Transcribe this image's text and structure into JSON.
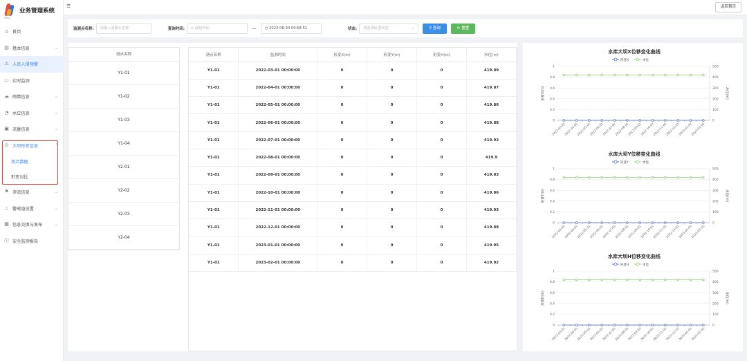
{
  "app": {
    "title": "业务管理系统",
    "logo_sub": "ABAC"
  },
  "topbar": {
    "fold_icon": "☰",
    "back_label": "返回首页"
  },
  "sidebar": {
    "items": [
      {
        "label": "首页",
        "icon": "home-icon",
        "glyph": "⌂",
        "chevron": false
      },
      {
        "label": "基本信息",
        "icon": "info-icon",
        "glyph": "▤",
        "chevron": true
      },
      {
        "label": "人员入侵预警",
        "icon": "alert-icon",
        "glyph": "⚠",
        "chevron": false,
        "active": true
      },
      {
        "label": "实时监测",
        "icon": "monitor-icon",
        "glyph": "▭",
        "chevron": false
      },
      {
        "label": "雨情信息",
        "icon": "rain-icon",
        "glyph": "☁",
        "chevron": true
      },
      {
        "label": "水位信息",
        "icon": "water-icon",
        "glyph": "◔",
        "chevron": true
      },
      {
        "label": "流量信息",
        "icon": "flow-icon",
        "glyph": "▣",
        "chevron": true
      },
      {
        "label": "大坝形变信息",
        "icon": "dam-icon",
        "glyph": "⊙",
        "chevron": true,
        "selected": true
      },
      {
        "label": "测点数据",
        "sub": true,
        "selected": true
      },
      {
        "label": "形变对比",
        "sub": true
      },
      {
        "label": "渗流信息",
        "icon": "seepage-icon",
        "glyph": "⚑",
        "chevron": true
      },
      {
        "label": "警戒值设置",
        "icon": "warning-icon",
        "glyph": "♨",
        "chevron": true
      },
      {
        "label": "信息交换与发布",
        "icon": "exchange-icon",
        "glyph": "▦",
        "chevron": true
      },
      {
        "label": "安全监测报告",
        "icon": "report-icon",
        "glyph": "ⓘ",
        "chevron": false
      }
    ]
  },
  "filter": {
    "station_label": "监测点名称:",
    "station_placeholder": "请输入测量头名称",
    "time_label": "查询时间:",
    "start_placeholder": "起始时间",
    "end_value": "2023-08-30 09:58:51",
    "status_label": "状态:",
    "status_placeholder": "请选择处理状态",
    "query_label": "查询",
    "reset_label": "重置"
  },
  "point_table": {
    "header": "测点名称",
    "rows": [
      "Y1-01",
      "Y1-02",
      "Y1-03",
      "Y1-04",
      "Y2-01",
      "Y2-02",
      "Y2-03",
      "Y2-04"
    ]
  },
  "data_table": {
    "headers": [
      "测点名称",
      "监测时间",
      "形变X(m)",
      "形变Y(m)",
      "形变H(m)",
      "水位(m)"
    ],
    "rows": [
      [
        "Y1-01",
        "2022-03-01 00:00:00",
        "0",
        "0",
        "0",
        "419.89"
      ],
      [
        "Y1-01",
        "2022-04-01 00:00:00",
        "0",
        "0",
        "0",
        "419.87"
      ],
      [
        "Y1-01",
        "2022-05-01 00:00:00",
        "0",
        "0",
        "0",
        "419.86"
      ],
      [
        "Y1-01",
        "2022-06-01 00:00:00",
        "0",
        "0",
        "0",
        "419.88"
      ],
      [
        "Y1-01",
        "2022-07-01 00:00:00",
        "0",
        "0",
        "0",
        "419.92"
      ],
      [
        "Y1-01",
        "2022-08-01 00:00:00",
        "0",
        "0",
        "0",
        "419.9"
      ],
      [
        "Y1-01",
        "2022-09-01 00:00:00",
        "0",
        "0",
        "0",
        "419.83"
      ],
      [
        "Y1-01",
        "2022-10-01 00:00:00",
        "0",
        "0",
        "0",
        "419.86"
      ],
      [
        "Y1-01",
        "2022-11-01 00:00:00",
        "0",
        "0",
        "0",
        "419.93"
      ],
      [
        "Y1-01",
        "2022-12-01 00:00:00",
        "0",
        "0",
        "0",
        "419.88"
      ],
      [
        "Y1-01",
        "2023-01-01 00:00:00",
        "0",
        "0",
        "0",
        "419.95"
      ],
      [
        "Y1-01",
        "2023-02-01 00:00:00",
        "0",
        "0",
        "0",
        "419.92"
      ]
    ]
  },
  "colors": {
    "accent": "#3a8ee6",
    "reset": "#5cb85c",
    "deform_line": "#5470c6",
    "water_line": "#91cc75",
    "highlight_box": "#e0463c"
  },
  "chart_data": [
    {
      "type": "line",
      "title": "水库大坝X位移变化曲线",
      "x": [
        "2022-03-01",
        "2022-04-01",
        "2022-05-01",
        "2022-06-01",
        "2022-07-01",
        "2022-08-01",
        "2022-09-01",
        "2022-10-01",
        "2022-11-01",
        "2022-12-01",
        "2023-01-01",
        "2023-02-01"
      ],
      "ylabel": "形变X(m)",
      "y2label": "水位(m)",
      "ylim": [
        0,
        1
      ],
      "y2lim": [
        0,
        500
      ],
      "yticks": [
        "0",
        "0.2",
        "0.4",
        "0.6",
        "0.8",
        "1"
      ],
      "y2ticks": [
        "0",
        "100",
        "200",
        "300",
        "400",
        "500"
      ],
      "series": [
        {
          "name": "形变X",
          "axis": "left",
          "values": [
            0,
            0,
            0,
            0,
            0,
            0,
            0,
            0,
            0,
            0,
            0,
            0
          ]
        },
        {
          "name": "水位",
          "axis": "right",
          "values": [
            419.89,
            419.87,
            419.86,
            419.88,
            419.92,
            419.9,
            419.83,
            419.86,
            419.93,
            419.88,
            419.95,
            419.92
          ]
        }
      ],
      "grid": true,
      "legend": "top-center"
    },
    {
      "type": "line",
      "title": "水库大坝Y位移变化曲线",
      "x": [
        "2022-03-01",
        "2022-04-01",
        "2022-05-01",
        "2022-06-01",
        "2022-07-01",
        "2022-08-01",
        "2022-09-01",
        "2022-10-01",
        "2022-11-01",
        "2022-12-01",
        "2023-01-01",
        "2023-02-01"
      ],
      "ylabel": "形变Y(m)",
      "y2label": "水位(m)",
      "ylim": [
        0,
        1
      ],
      "y2lim": [
        0,
        500
      ],
      "yticks": [
        "0",
        "0.2",
        "0.4",
        "0.6",
        "0.8",
        "1"
      ],
      "y2ticks": [
        "0",
        "100",
        "200",
        "300",
        "400",
        "500"
      ],
      "series": [
        {
          "name": "形变Y",
          "axis": "left",
          "values": [
            0,
            0,
            0,
            0,
            0,
            0,
            0,
            0,
            0,
            0,
            0,
            0
          ]
        },
        {
          "name": "水位",
          "axis": "right",
          "values": [
            419.89,
            419.87,
            419.86,
            419.88,
            419.92,
            419.9,
            419.83,
            419.86,
            419.93,
            419.88,
            419.95,
            419.92
          ]
        }
      ],
      "grid": true,
      "legend": "top-center"
    },
    {
      "type": "line",
      "title": "水库大坝H位移变化曲线",
      "x": [
        "2022-03-01",
        "2022-04-01",
        "2022-05-01",
        "2022-06-01",
        "2022-07-01",
        "2022-08-01",
        "2022-09-01",
        "2022-10-01",
        "2022-11-01",
        "2022-12-01",
        "2023-01-01",
        "2023-02-01"
      ],
      "ylabel": "形变H(m)",
      "y2label": "水位(m)",
      "ylim": [
        0,
        1
      ],
      "y2lim": [
        0,
        500
      ],
      "yticks": [
        "0",
        "0.2",
        "0.4",
        "0.6",
        "0.8",
        "1"
      ],
      "y2ticks": [
        "0",
        "100",
        "200",
        "300",
        "400",
        "500"
      ],
      "series": [
        {
          "name": "形变H",
          "axis": "left",
          "values": [
            0,
            0,
            0,
            0,
            0,
            0,
            0,
            0,
            0,
            0,
            0,
            0
          ]
        },
        {
          "name": "水位",
          "axis": "right",
          "values": [
            419.89,
            419.87,
            419.86,
            419.88,
            419.92,
            419.9,
            419.83,
            419.86,
            419.93,
            419.88,
            419.95,
            419.92
          ]
        }
      ],
      "grid": true,
      "legend": "top-center"
    }
  ]
}
